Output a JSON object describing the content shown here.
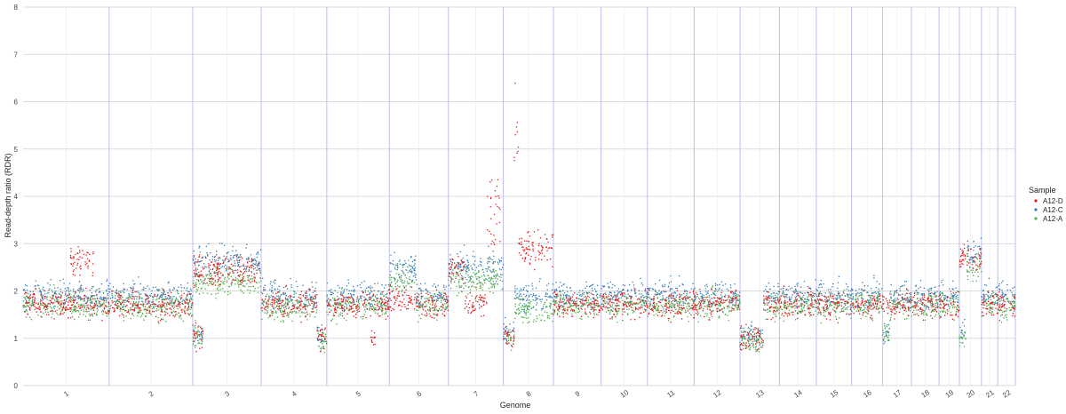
{
  "chart_data": {
    "type": "scatter",
    "xlabel": "Genome",
    "ylabel": "Read-depth ratio (RDR)",
    "ylim": [
      0,
      8
    ],
    "yticks": [
      0,
      1,
      2,
      3,
      4,
      5,
      6,
      7,
      8
    ],
    "grid": true,
    "legend": {
      "title": "Sample",
      "position": "right"
    },
    "chromosomes": [
      "1",
      "2",
      "3",
      "4",
      "5",
      "6",
      "7",
      "8",
      "9",
      "10",
      "11",
      "12",
      "13",
      "14",
      "15",
      "16",
      "17",
      "18",
      "19",
      "20",
      "21",
      "22"
    ],
    "chromosome_lengths_mb": [
      249,
      242,
      198,
      190,
      181,
      171,
      159,
      145,
      138,
      134,
      135,
      133,
      114,
      107,
      102,
      90,
      83,
      80,
      59,
      64,
      47,
      51
    ],
    "series": [
      {
        "name": "A12-D",
        "color": "#e41a1c",
        "baseline": 1.72,
        "segments": [
          {
            "chrom": "1",
            "start": 0.0,
            "end": 1.0,
            "level": 1.72
          },
          {
            "chrom": "1",
            "start": 0.55,
            "end": 0.82,
            "level": 2.6
          },
          {
            "chrom": "2",
            "start": 0.0,
            "end": 1.0,
            "level": 1.72
          },
          {
            "chrom": "3",
            "start": 0.0,
            "end": 1.0,
            "level": 2.45
          },
          {
            "chrom": "3",
            "start": 0.0,
            "end": 0.15,
            "level": 1.1
          },
          {
            "chrom": "4",
            "start": 0.0,
            "end": 0.85,
            "level": 1.72
          },
          {
            "chrom": "4",
            "start": 0.85,
            "end": 1.0,
            "level": 1.0
          },
          {
            "chrom": "5",
            "start": 0.0,
            "end": 1.0,
            "level": 1.72
          },
          {
            "chrom": "5",
            "start": 0.7,
            "end": 0.78,
            "level": 1.02
          },
          {
            "chrom": "6",
            "start": 0.0,
            "end": 0.45,
            "level": 1.82
          },
          {
            "chrom": "6",
            "start": 0.45,
            "end": 1.0,
            "level": 1.72
          },
          {
            "chrom": "7",
            "start": 0.0,
            "end": 0.3,
            "level": 2.45
          },
          {
            "chrom": "7",
            "start": 0.3,
            "end": 0.7,
            "level": 1.78
          },
          {
            "chrom": "7",
            "start": 0.7,
            "end": 0.95,
            "level": 3.6
          },
          {
            "chrom": "8",
            "start": 0.0,
            "end": 0.22,
            "level": 1.0
          },
          {
            "chrom": "8",
            "start": 0.22,
            "end": 0.3,
            "level": 5.5
          },
          {
            "chrom": "8",
            "start": 0.3,
            "end": 1.0,
            "level": 2.9
          },
          {
            "chrom": "9",
            "start": 0.0,
            "end": 1.0,
            "level": 1.72
          },
          {
            "chrom": "10",
            "start": 0.0,
            "end": 1.0,
            "level": 1.72
          },
          {
            "chrom": "11",
            "start": 0.0,
            "end": 1.0,
            "level": 1.72
          },
          {
            "chrom": "12",
            "start": 0.0,
            "end": 1.0,
            "level": 1.72
          },
          {
            "chrom": "13",
            "start": 0.0,
            "end": 0.6,
            "level": 1.0
          },
          {
            "chrom": "13",
            "start": 0.6,
            "end": 1.0,
            "level": 1.72
          },
          {
            "chrom": "14",
            "start": 0.0,
            "end": 1.0,
            "level": 1.72
          },
          {
            "chrom": "15",
            "start": 0.0,
            "end": 1.0,
            "level": 1.72
          },
          {
            "chrom": "16",
            "start": 0.0,
            "end": 1.0,
            "level": 1.72
          },
          {
            "chrom": "17",
            "start": 0.0,
            "end": 1.0,
            "level": 1.72
          },
          {
            "chrom": "18",
            "start": 0.0,
            "end": 1.0,
            "level": 1.72
          },
          {
            "chrom": "19",
            "start": 0.0,
            "end": 1.0,
            "level": 1.72
          },
          {
            "chrom": "20",
            "start": 0.0,
            "end": 1.0,
            "level": 2.7
          },
          {
            "chrom": "21",
            "start": 0.0,
            "end": 1.0,
            "level": 1.72
          },
          {
            "chrom": "22",
            "start": 0.0,
            "end": 1.0,
            "level": 1.72
          }
        ]
      },
      {
        "name": "A12-C",
        "color": "#377eb8",
        "baseline": 1.9,
        "segments": [
          {
            "chrom": "1",
            "start": 0.0,
            "end": 1.0,
            "level": 1.9
          },
          {
            "chrom": "2",
            "start": 0.0,
            "end": 1.0,
            "level": 1.9
          },
          {
            "chrom": "3",
            "start": 0.0,
            "end": 1.0,
            "level": 2.6
          },
          {
            "chrom": "3",
            "start": 0.0,
            "end": 0.15,
            "level": 1.1
          },
          {
            "chrom": "4",
            "start": 0.0,
            "end": 0.85,
            "level": 1.9
          },
          {
            "chrom": "4",
            "start": 0.85,
            "end": 1.0,
            "level": 1.05
          },
          {
            "chrom": "5",
            "start": 0.0,
            "end": 1.0,
            "level": 1.9
          },
          {
            "chrom": "6",
            "start": 0.0,
            "end": 0.45,
            "level": 2.5
          },
          {
            "chrom": "6",
            "start": 0.45,
            "end": 1.0,
            "level": 1.9
          },
          {
            "chrom": "7",
            "start": 0.0,
            "end": 1.0,
            "level": 2.5
          },
          {
            "chrom": "8",
            "start": 0.0,
            "end": 0.22,
            "level": 1.1
          },
          {
            "chrom": "8",
            "start": 0.22,
            "end": 1.0,
            "level": 1.9
          },
          {
            "chrom": "9",
            "start": 0.0,
            "end": 1.0,
            "level": 1.9
          },
          {
            "chrom": "10",
            "start": 0.0,
            "end": 1.0,
            "level": 1.9
          },
          {
            "chrom": "11",
            "start": 0.0,
            "end": 1.0,
            "level": 1.9
          },
          {
            "chrom": "12",
            "start": 0.0,
            "end": 1.0,
            "level": 1.9
          },
          {
            "chrom": "13",
            "start": 0.0,
            "end": 0.6,
            "level": 1.05
          },
          {
            "chrom": "13",
            "start": 0.6,
            "end": 1.0,
            "level": 1.9
          },
          {
            "chrom": "14",
            "start": 0.0,
            "end": 1.0,
            "level": 1.9
          },
          {
            "chrom": "15",
            "start": 0.0,
            "end": 1.0,
            "level": 1.9
          },
          {
            "chrom": "16",
            "start": 0.0,
            "end": 1.0,
            "level": 1.9
          },
          {
            "chrom": "17",
            "start": 0.0,
            "end": 0.25,
            "level": 1.1
          },
          {
            "chrom": "17",
            "start": 0.25,
            "end": 1.0,
            "level": 1.9
          },
          {
            "chrom": "18",
            "start": 0.0,
            "end": 1.0,
            "level": 1.9
          },
          {
            "chrom": "19",
            "start": 0.0,
            "end": 1.0,
            "level": 1.9
          },
          {
            "chrom": "20",
            "start": 0.0,
            "end": 0.3,
            "level": 1.1
          },
          {
            "chrom": "20",
            "start": 0.3,
            "end": 1.0,
            "level": 2.8
          },
          {
            "chrom": "21",
            "start": 0.0,
            "end": 1.0,
            "level": 1.9
          },
          {
            "chrom": "22",
            "start": 0.0,
            "end": 1.0,
            "level": 1.9
          }
        ]
      },
      {
        "name": "A12-A",
        "color": "#4daf4a",
        "baseline": 1.7,
        "segments": [
          {
            "chrom": "1",
            "start": 0.0,
            "end": 1.0,
            "level": 1.7
          },
          {
            "chrom": "2",
            "start": 0.0,
            "end": 1.0,
            "level": 1.7
          },
          {
            "chrom": "3",
            "start": 0.0,
            "end": 1.0,
            "level": 2.2
          },
          {
            "chrom": "3",
            "start": 0.0,
            "end": 0.15,
            "level": 1.05
          },
          {
            "chrom": "4",
            "start": 0.0,
            "end": 0.85,
            "level": 1.65
          },
          {
            "chrom": "4",
            "start": 0.85,
            "end": 1.0,
            "level": 0.95
          },
          {
            "chrom": "5",
            "start": 0.0,
            "end": 1.0,
            "level": 1.7
          },
          {
            "chrom": "6",
            "start": 0.0,
            "end": 0.45,
            "level": 2.3
          },
          {
            "chrom": "6",
            "start": 0.45,
            "end": 1.0,
            "level": 1.7
          },
          {
            "chrom": "7",
            "start": 0.0,
            "end": 1.0,
            "level": 2.2
          },
          {
            "chrom": "8",
            "start": 0.0,
            "end": 0.22,
            "level": 1.0
          },
          {
            "chrom": "8",
            "start": 0.22,
            "end": 1.0,
            "level": 1.6
          },
          {
            "chrom": "9",
            "start": 0.0,
            "end": 1.0,
            "level": 1.7
          },
          {
            "chrom": "10",
            "start": 0.0,
            "end": 1.0,
            "level": 1.7
          },
          {
            "chrom": "11",
            "start": 0.0,
            "end": 1.0,
            "level": 1.7
          },
          {
            "chrom": "12",
            "start": 0.0,
            "end": 1.0,
            "level": 1.7
          },
          {
            "chrom": "13",
            "start": 0.0,
            "end": 0.6,
            "level": 0.95
          },
          {
            "chrom": "13",
            "start": 0.6,
            "end": 1.0,
            "level": 1.7
          },
          {
            "chrom": "14",
            "start": 0.0,
            "end": 1.0,
            "level": 1.7
          },
          {
            "chrom": "15",
            "start": 0.0,
            "end": 1.0,
            "level": 1.7
          },
          {
            "chrom": "16",
            "start": 0.0,
            "end": 1.0,
            "level": 1.7
          },
          {
            "chrom": "17",
            "start": 0.0,
            "end": 0.25,
            "level": 1.05
          },
          {
            "chrom": "17",
            "start": 0.25,
            "end": 1.0,
            "level": 1.7
          },
          {
            "chrom": "18",
            "start": 0.0,
            "end": 1.0,
            "level": 1.7
          },
          {
            "chrom": "19",
            "start": 0.0,
            "end": 1.0,
            "level": 1.7
          },
          {
            "chrom": "20",
            "start": 0.0,
            "end": 0.3,
            "level": 1.0
          },
          {
            "chrom": "20",
            "start": 0.3,
            "end": 1.0,
            "level": 2.55
          },
          {
            "chrom": "21",
            "start": 0.0,
            "end": 1.0,
            "level": 1.7
          },
          {
            "chrom": "22",
            "start": 0.0,
            "end": 1.0,
            "level": 1.7
          }
        ]
      }
    ]
  }
}
